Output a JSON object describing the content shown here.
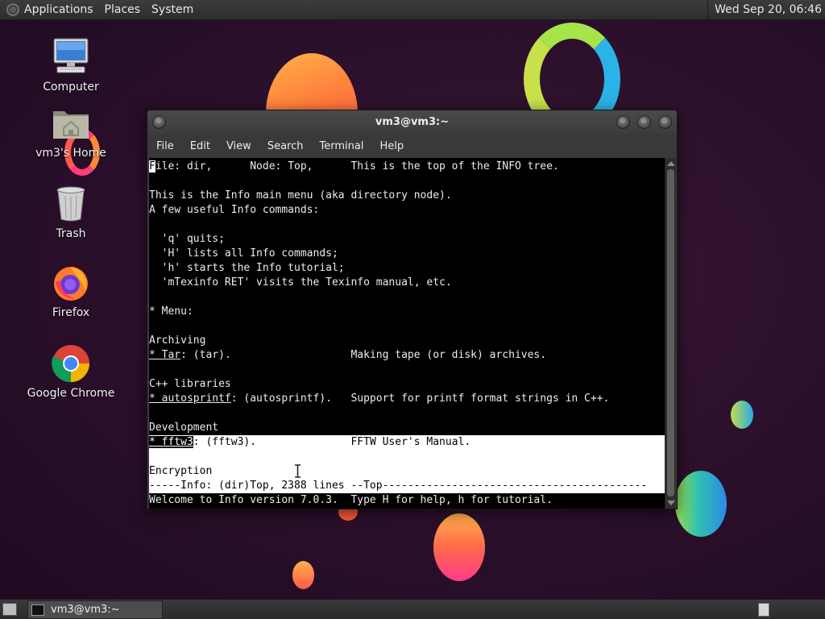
{
  "top_panel": {
    "menus": [
      "Applications",
      "Places",
      "System"
    ],
    "clock": "Wed Sep 20, 06:46"
  },
  "desktop_icons": [
    {
      "label": "Computer",
      "icon": "computer-icon"
    },
    {
      "label": "vm3's Home",
      "icon": "home-folder-icon"
    },
    {
      "label": "Trash",
      "icon": "trash-icon"
    },
    {
      "label": "Firefox",
      "icon": "firefox-icon"
    },
    {
      "label": "Google Chrome",
      "icon": "chrome-icon"
    }
  ],
  "window": {
    "title": "vm3@vm3:~",
    "menus": [
      "File",
      "Edit",
      "View",
      "Search",
      "Terminal",
      "Help"
    ]
  },
  "terminal": {
    "header_first_char": "F",
    "header_rest": "ile: dir,      Node: Top,      This is the top of the INFO tree.",
    "lines": [
      "This is the Info main menu (aka directory node).",
      "A few useful Info commands:",
      "  'q' quits;",
      "  'H' lists all Info commands;",
      "  'h' starts the Info tutorial;",
      "  'mTexinfo RET' visits the Texinfo manual, etc.",
      "* Menu:",
      "Archiving"
    ],
    "tar_link": "* Tar",
    "tar_rest": ": (tar).                   Making tape (or disk) archives.",
    "cpp_heading": "C++ libraries",
    "autosprintf_link": "* autosprintf",
    "autosprintf_rest": ": (autosprintf).   Support for printf format strings in C++.",
    "development_heading": "Development",
    "fftw3_link": "* fftw3",
    "fftw3_rest": ": (fftw3).               FFTW User's Manual.",
    "encryption_heading": "Encryption",
    "mode_line": "-----Info: (dir)Top, 2388 lines --Top------------------------------------------",
    "echo_line": "Welcome to Info version 7.0.3.  Type H for help, h for tutorial."
  },
  "taskbar": {
    "task_label": "vm3@vm3:~"
  },
  "colors": {
    "panel": "#2d2d2d",
    "desktop_bg": "#2a0f2a",
    "terminal_bg": "#000000",
    "terminal_fg": "#ececec"
  }
}
